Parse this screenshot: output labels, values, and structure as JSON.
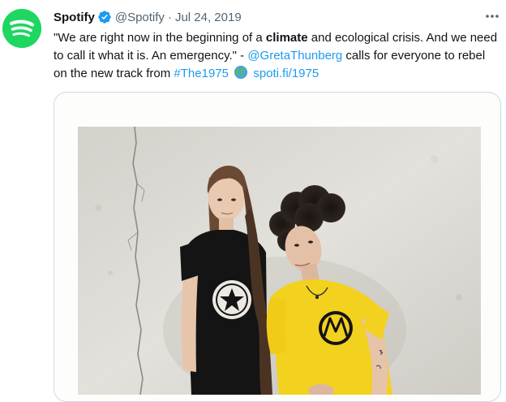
{
  "tweet": {
    "author_name": "Spotify",
    "author_handle": "@Spotify",
    "separator": "·",
    "date": "Jul 24, 2019",
    "text": {
      "part1": "\"We are right now in the beginning of a ",
      "bold_word": "climate",
      "part2": " and ecological crisis. And we need to call it what it is. An emergency.\" - ",
      "mention": "@GretaThunberg",
      "part3": " calls for everyone to rebel on the new track from ",
      "hashtag": "#The1975",
      "link": "spoti.fi/1975"
    },
    "icons": {
      "avatar": "spotify-logo",
      "verified": "verified-badge-icon",
      "more": "more-options-icon",
      "globe": "globe-emoji"
    },
    "colors": {
      "brand_green": "#1ed760",
      "link_blue": "#1d9bf0",
      "secondary_text": "#536471"
    }
  },
  "media": {
    "shirt_left_text": "ANTIFA ALL STAR",
    "shirt_right_text": "MOTOROLA INC"
  }
}
